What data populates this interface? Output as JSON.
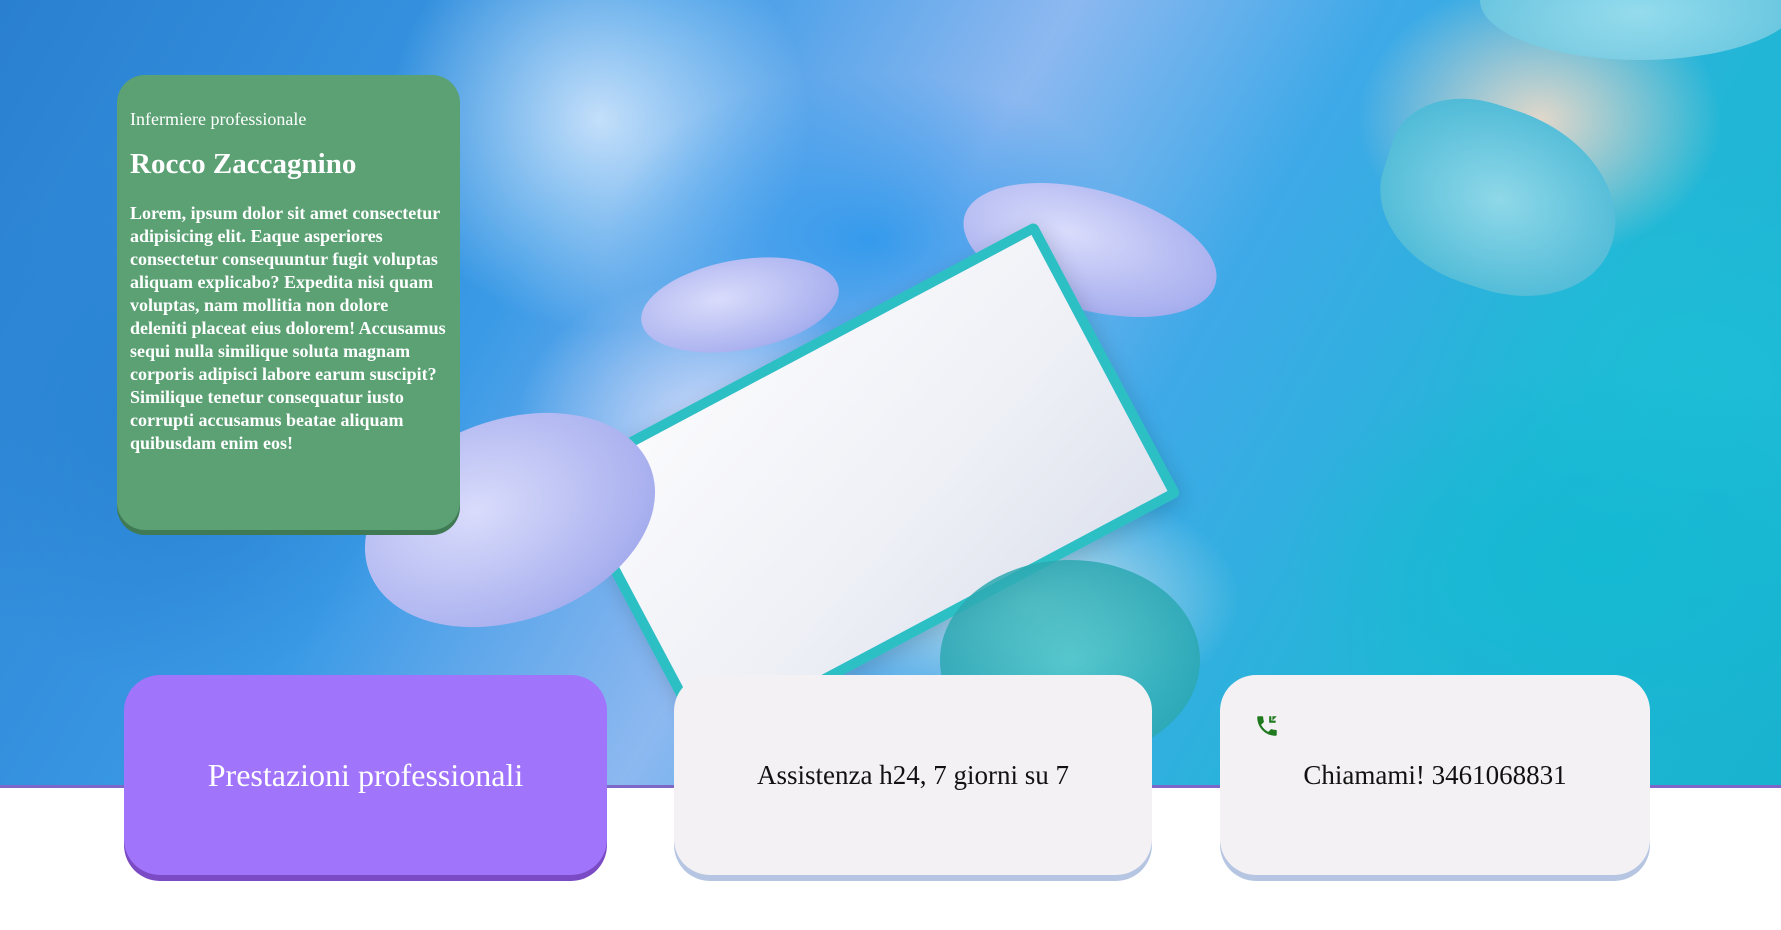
{
  "profile": {
    "role": "Infermiere professionale",
    "name": "Rocco Zaccagnino",
    "description": "Lorem, ipsum dolor sit amet consectetur adipisicing elit. Eaque asperiores consectetur consequuntur fugit voluptas aliquam explicabo? Expedita nisi quam voluptas, nam mollitia non dolore deleniti placeat eius dolorem! Accusamus sequi nulla similique soluta magnam corporis adipisci labore earum suscipit? Similique tenetur consequatur iusto corrupti accusamus beatae aliquam quibusdam enim eos!"
  },
  "cards": {
    "services": {
      "label": "Prestazioni professionali"
    },
    "assistance": {
      "label": "Assistenza h24, 7 giorni su 7"
    },
    "call": {
      "label": "Chiamami! 3461068831",
      "icon": "phone-icon"
    }
  },
  "colors": {
    "profile_card": "#5ba174",
    "services_card": "#a074fb",
    "light_card": "#f3f1f3",
    "phone_icon": "#1f7a1f"
  },
  "hero": {
    "image": "operating-room-nurse-photo"
  }
}
